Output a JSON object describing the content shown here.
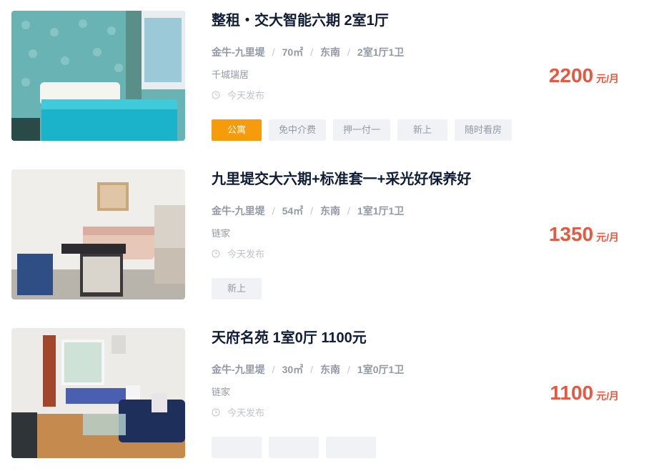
{
  "listings": [
    {
      "title": "整租・交大智能六期 2室1厅",
      "district": "金牛-九里堤",
      "area": "70㎡",
      "orientation": "东南",
      "layout": "2室1厅1卫",
      "agency": "千城瑞居",
      "posted": "今天发布",
      "tags": [
        "公寓",
        "免中介费",
        "押一付一",
        "新上",
        "随时看房"
      ],
      "price": "2200",
      "price_unit": "元/月",
      "image": "bedroom-teal"
    },
    {
      "title": "九里堤交大六期+标准套一+采光好保养好",
      "district": "金牛-九里堤",
      "area": "54㎡",
      "orientation": "东南",
      "layout": "1室1厅1卫",
      "agency": "链家",
      "posted": "今天发布",
      "tags": [
        "新上"
      ],
      "price": "1350",
      "price_unit": "元/月",
      "image": "living-room"
    },
    {
      "title": "天府名苑 1室0厅 1100元",
      "district": "金牛-九里堤",
      "area": "30㎡",
      "orientation": "东南",
      "layout": "1室0厅1卫",
      "agency": "链家",
      "posted": "今天发布",
      "tags": [
        "",
        "",
        ""
      ],
      "price": "1100",
      "price_unit": "元/月",
      "image": "studio-room"
    }
  ],
  "colors": {
    "price": "#e4593f",
    "primary_tag": "#f59b0c",
    "title": "#101d37",
    "muted": "#9399a5"
  },
  "icons": {
    "posted": "clock-icon"
  }
}
